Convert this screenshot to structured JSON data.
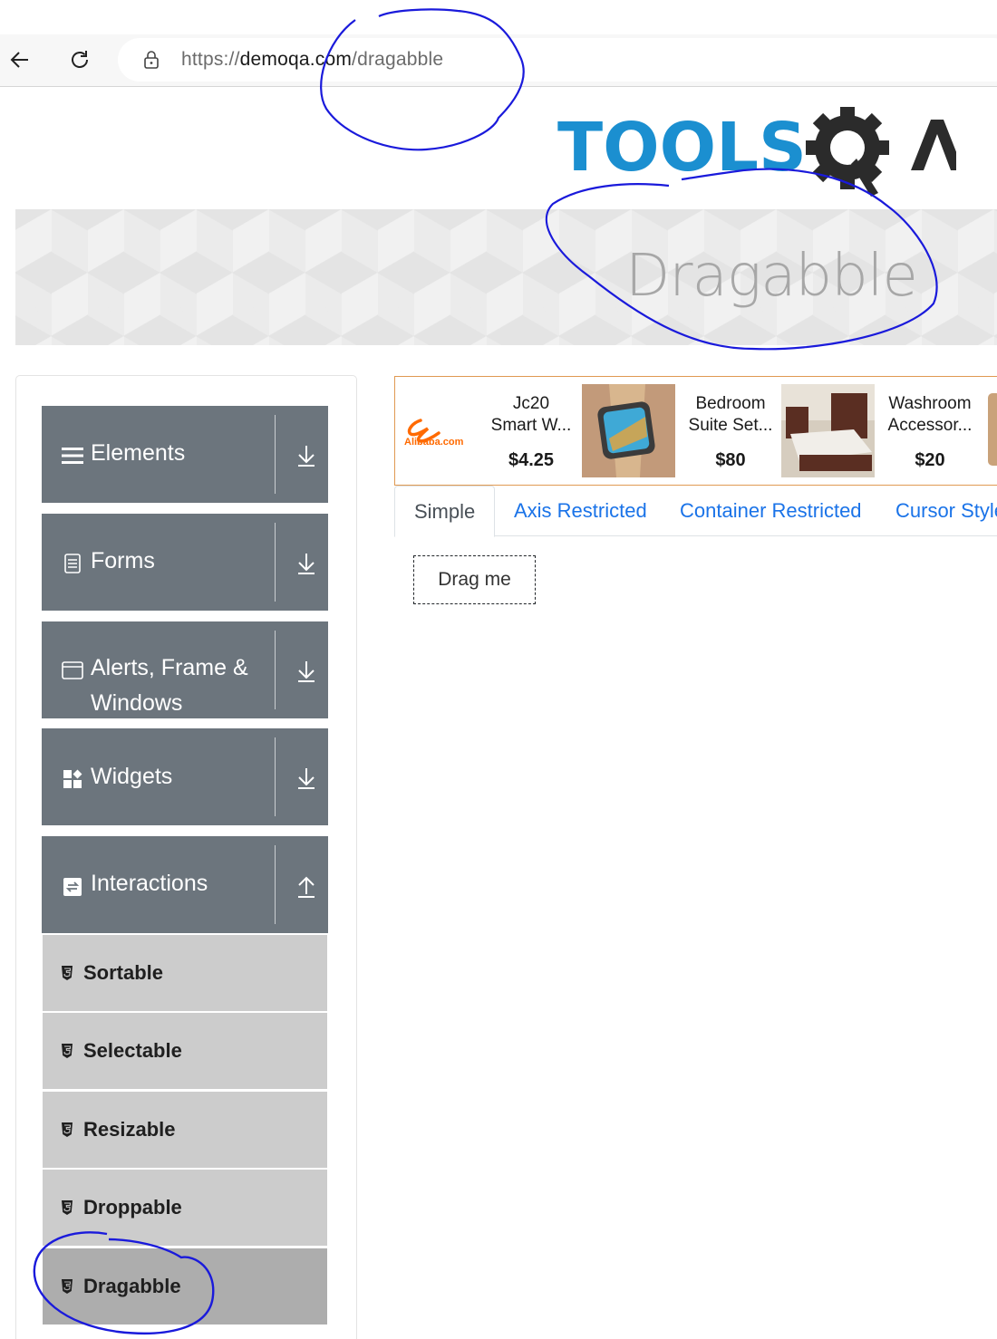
{
  "browser": {
    "url_scheme": "https://",
    "url_host": "demoqa.com",
    "url_path": "/dragabble"
  },
  "header": {
    "logo_text": "TOOLSQA"
  },
  "banner": {
    "title": "Dragabble"
  },
  "sidebar": {
    "groups": [
      {
        "label": "Elements",
        "icon": "list-icon",
        "expanded": false
      },
      {
        "label": "Forms",
        "icon": "form-icon",
        "expanded": false
      },
      {
        "label": "Alerts, Frame & Windows",
        "icon": "window-icon",
        "expanded": false
      },
      {
        "label": "Widgets",
        "icon": "widgets-icon",
        "expanded": false
      },
      {
        "label": "Interactions",
        "icon": "interactions-icon",
        "expanded": true
      }
    ],
    "items": [
      {
        "label": "Sortable",
        "active": false
      },
      {
        "label": "Selectable",
        "active": false
      },
      {
        "label": "Resizable",
        "active": false
      },
      {
        "label": "Droppable",
        "active": false
      },
      {
        "label": "Dragabble",
        "active": true
      }
    ]
  },
  "ad": {
    "brand": "Alibaba.com",
    "products": [
      {
        "name_line1": "Jc20",
        "name_line2": "Smart W...",
        "price": "$4.25"
      },
      {
        "name_line1": "Bedroom",
        "name_line2": "Suite Set...",
        "price": "$80"
      },
      {
        "name_line1": "Washroom",
        "name_line2": "Accessor...",
        "price": "$20"
      }
    ]
  },
  "tabs": [
    {
      "label": "Simple",
      "active": true
    },
    {
      "label": "Axis Restricted",
      "active": false
    },
    {
      "label": "Container Restricted",
      "active": false
    },
    {
      "label": "Cursor Style",
      "active": false
    }
  ],
  "drag_box": {
    "label": "Drag me"
  },
  "colors": {
    "group_bg": "#6c757d",
    "item_bg": "#cccccc",
    "item_active_bg": "#adadad",
    "link": "#1a73e8",
    "annotation": "#1a1adb"
  }
}
